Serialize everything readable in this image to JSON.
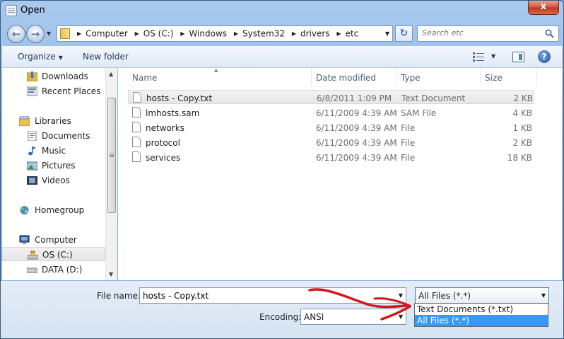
{
  "window": {
    "title": "Open",
    "close_label": "x"
  },
  "address": {
    "crumbs": [
      "Computer",
      "OS (C:)",
      "Windows",
      "System32",
      "drivers",
      "etc"
    ]
  },
  "search": {
    "placeholder": "Search etc"
  },
  "toolbar": {
    "organize_label": "Organize",
    "new_folder_label": "New folder",
    "help_label": "?"
  },
  "navpane": {
    "favorites": [
      {
        "label": "Downloads",
        "icon": "downloads-folder-icon"
      },
      {
        "label": "Recent Places",
        "icon": "recent-places-icon"
      }
    ],
    "libraries_label": "Libraries",
    "libraries": [
      {
        "label": "Documents",
        "icon": "documents-icon"
      },
      {
        "label": "Music",
        "icon": "music-icon"
      },
      {
        "label": "Pictures",
        "icon": "pictures-icon"
      },
      {
        "label": "Videos",
        "icon": "videos-icon"
      }
    ],
    "homegroup_label": "Homegroup",
    "computer_label": "Computer",
    "drives": [
      {
        "label": "OS (C:)",
        "selected": true
      },
      {
        "label": "DATA (D:)",
        "selected": false
      }
    ]
  },
  "columns": {
    "name": "Name",
    "date": "Date modified",
    "type": "Type",
    "size": "Size"
  },
  "files": [
    {
      "name": "hosts - Copy.txt",
      "date": "6/8/2011 1:09 PM",
      "type": "Text Document",
      "size": "2 KB",
      "selected": true
    },
    {
      "name": "lmhosts.sam",
      "date": "6/11/2009 4:39 AM",
      "type": "SAM File",
      "size": "4 KB"
    },
    {
      "name": "networks",
      "date": "6/11/2009 4:39 AM",
      "type": "File",
      "size": "1 KB"
    },
    {
      "name": "protocol",
      "date": "6/11/2009 4:39 AM",
      "type": "File",
      "size": "2 KB"
    },
    {
      "name": "services",
      "date": "6/11/2009 4:39 AM",
      "type": "File",
      "size": "18 KB"
    }
  ],
  "bottom": {
    "filename_label": "File name:",
    "filename_value": "hosts - Copy.txt",
    "filter_value": "All Files  (*.*)",
    "encoding_label": "Encoding:",
    "encoding_value": "ANSI",
    "filter_options": [
      "Text Documents (*.txt)",
      "All Files  (*.*)"
    ]
  },
  "colors": {
    "selection_blue": "#3399ff",
    "annotation_red": "#d8141c"
  }
}
